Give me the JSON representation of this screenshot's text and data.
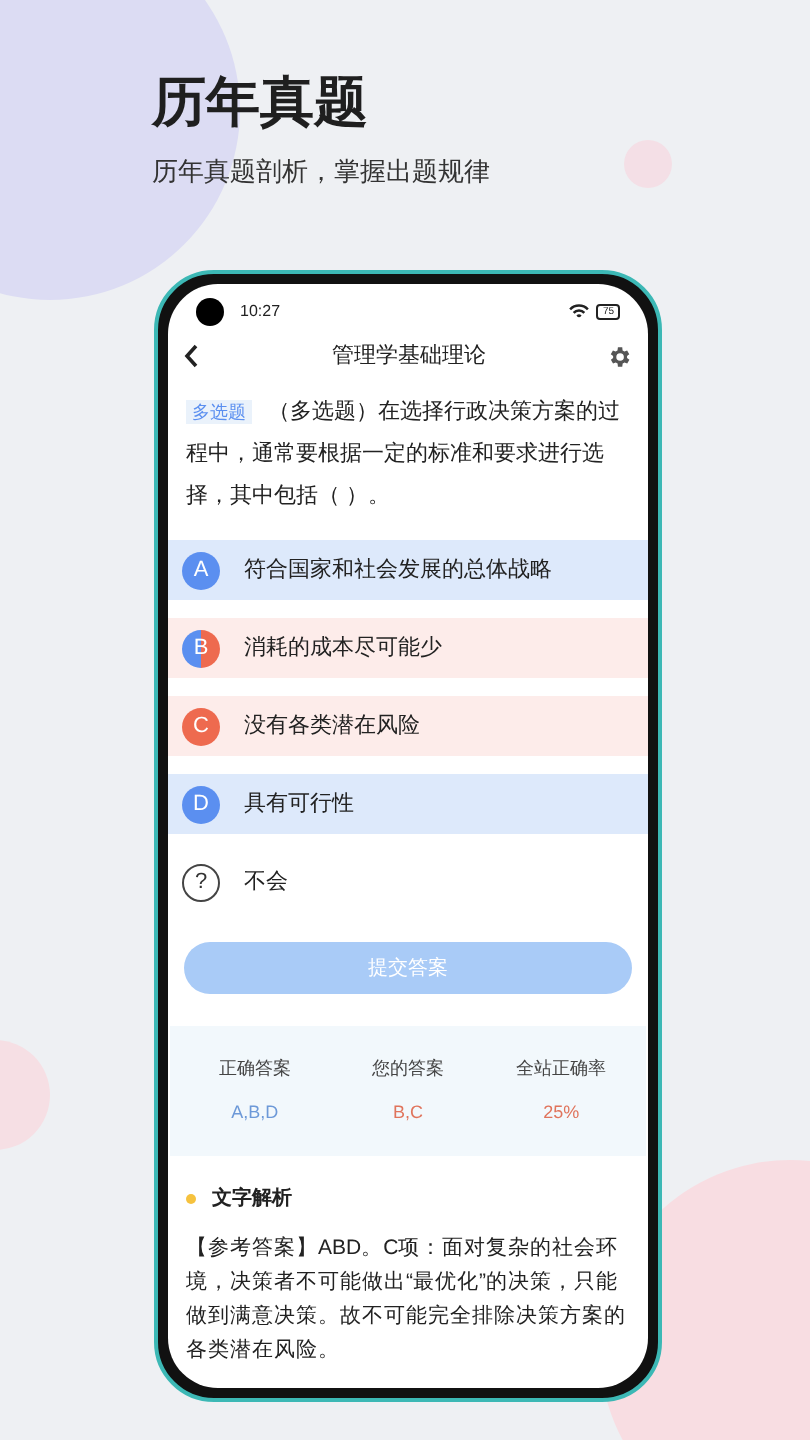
{
  "header": {
    "title": "历年真题",
    "subtitle": "历年真题剖析，掌握出题规律"
  },
  "status_bar": {
    "time": "10:27",
    "battery": "75"
  },
  "nav": {
    "title": "管理学基础理论"
  },
  "question": {
    "tag": "多选题",
    "text": "（多选题）在选择行政决策方案的过程中，通常要根据一定的标准和要求进行选择，其中包括（ ）。"
  },
  "options": [
    {
      "letter": "A",
      "text": "符合国家和社会发展的总体战略",
      "correct": true,
      "chosen": false
    },
    {
      "letter": "B",
      "text": "消耗的成本尽可能少",
      "correct": true,
      "chosen": true
    },
    {
      "letter": "C",
      "text": "没有各类潜在风险",
      "correct": false,
      "chosen": true
    },
    {
      "letter": "D",
      "text": "具有可行性",
      "correct": true,
      "chosen": false
    }
  ],
  "unknown_option": {
    "icon": "?",
    "text": "不会"
  },
  "submit_button": {
    "label": "提交答案",
    "disabled": true
  },
  "stats": [
    {
      "label": "正确答案",
      "value": "A,B,D",
      "kind": "correct"
    },
    {
      "label": "您的答案",
      "value": "B,C",
      "kind": "wrong"
    },
    {
      "label": "全站正确率",
      "value": "25%",
      "kind": "wrong"
    }
  ],
  "analysis": {
    "title": "文字解析",
    "text": "【参考答案】ABD。C项：面对复杂的社会环境，决策者不可能做出“最优化”的决策，只能做到满意决策。故不可能完全排除决策方案的各类潜在风险。"
  }
}
